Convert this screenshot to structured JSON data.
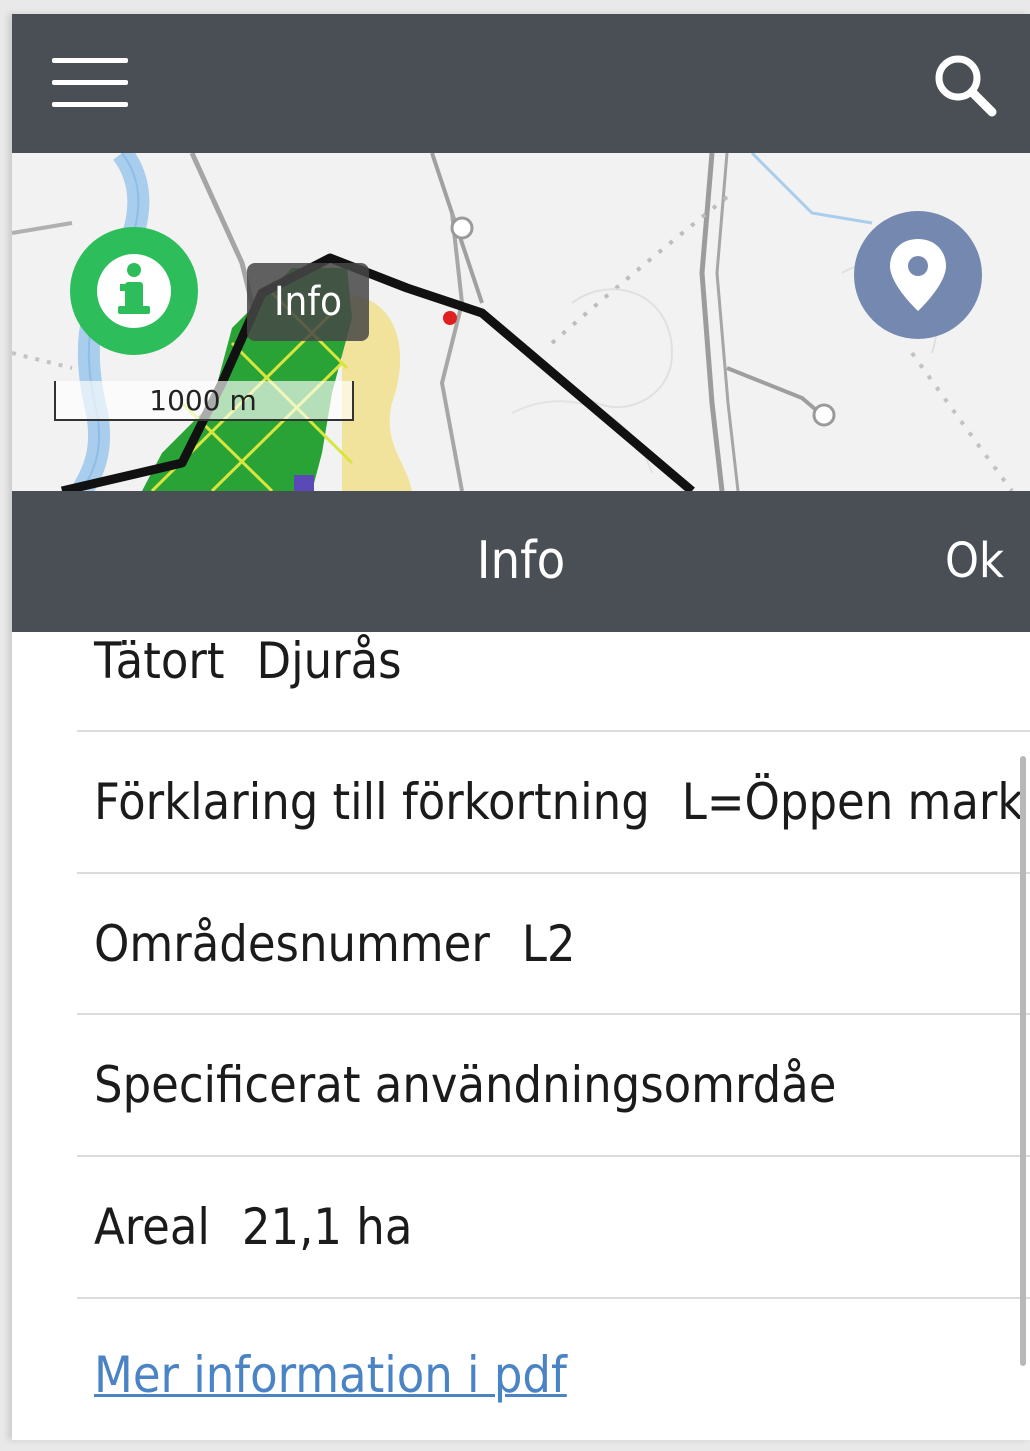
{
  "topbar": {
    "menu_icon": "hamburger-menu-icon",
    "search_icon": "search-icon",
    "background": "#4a4f56"
  },
  "map": {
    "info_button_icon": "info-icon",
    "info_button_color": "#2ebd5b",
    "tooltip": "Info",
    "location_button_icon": "location-pin-icon",
    "location_button_color": "#7589b0",
    "scale_label": "1000 m"
  },
  "panel": {
    "title": "Info",
    "ok_label": "Ok"
  },
  "attributes": [
    {
      "label": "Tätort",
      "value": "Djurås"
    },
    {
      "label": "Förklaring till förkortning",
      "value": "L=Öppen mark"
    },
    {
      "label": "Områdesnummer",
      "value": "L2"
    },
    {
      "label": "Specificerat användningsomrdåe",
      "value": ""
    },
    {
      "label": "Areal",
      "value": "21,1 ha"
    }
  ],
  "link": {
    "label": "Mer information i pdf",
    "color": "#4b84c4"
  }
}
